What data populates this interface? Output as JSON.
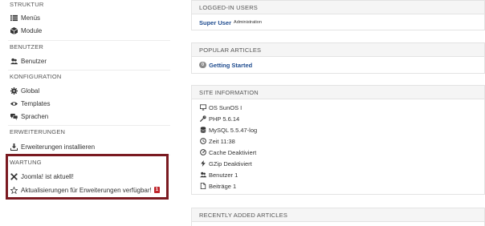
{
  "sidebar": {
    "sections": {
      "struktur": "STRUKTUR",
      "benutzer": "BENUTZER",
      "konfiguration": "KONFIGURATION",
      "erweiterungen": "ERWEITERUNGEN",
      "wartung": "WARTUNG"
    },
    "items": {
      "menus": "Menüs",
      "module": "Module",
      "benutzer": "Benutzer",
      "global": "Global",
      "templates": "Templates",
      "sprachen": "Sprachen",
      "install": "Erweiterungen installieren",
      "joomla_ok": "Joomla! ist aktuell!",
      "updates": "Aktualisierungen für Erweiterungen verfügbar!",
      "updates_count": "1"
    }
  },
  "panels": {
    "logged_in": {
      "title": "LOGGED-IN USERS",
      "user": "Super User",
      "role": "Administration"
    },
    "popular": {
      "title": "POPULAR ARTICLES",
      "hits": "0",
      "article": "Getting Started"
    },
    "site_info": {
      "title": "SITE INFORMATION",
      "os": "OS SunOS I",
      "php": "PHP 5.6.14",
      "mysql": "MySQL 5.5.47-log",
      "time": "Zeit 11:38",
      "cache": "Cache Deaktiviert",
      "gzip": "GZip Deaktiviert",
      "users": "Benutzer 1",
      "articles": "Beiträge 1"
    },
    "recent": {
      "title": "RECENTLY ADDED ARTICLES"
    }
  }
}
